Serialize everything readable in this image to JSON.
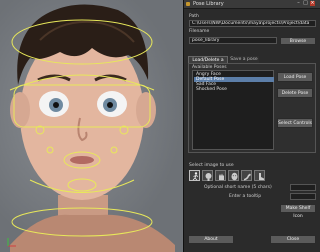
{
  "window": {
    "title": "Pose Library"
  },
  "path": {
    "label": "Path",
    "value": "C:\\Users\\NW\\Documents\\maya\\projects\\Project\\data"
  },
  "filename": {
    "label": "Filename",
    "value": "pose_library",
    "browse_label": "Browse"
  },
  "tabs": [
    {
      "label": "Load/Delete a pose",
      "active": true
    },
    {
      "label": "Save a pose",
      "active": false
    }
  ],
  "poses": {
    "header": "Available Poses",
    "items": [
      {
        "label": "Angry Face",
        "selected": false
      },
      {
        "label": "Default Pose",
        "selected": true
      },
      {
        "label": "Sad Face",
        "selected": false
      },
      {
        "label": "Shocked Pose",
        "selected": false
      }
    ]
  },
  "actions": {
    "load": "Load Pose",
    "delete": "Delete Pose",
    "select_controls": "Select Controls"
  },
  "image_select": {
    "label": "Select image to use",
    "icons": [
      "running-figure-icon",
      "head-icon",
      "hand-icon",
      "face-icon",
      "arm-icon",
      "foot-icon"
    ]
  },
  "short_name": {
    "label": "Optional short name (5 chars)"
  },
  "tooltip": {
    "label": "Enter a tooltip"
  },
  "shelf_button": "Make Shelf Icon",
  "footer": {
    "about": "About",
    "close": "Close"
  },
  "colors": {
    "selection": "#5c7ea8",
    "controls": "#e8e85a",
    "window_bg": "#2b2b2b"
  }
}
